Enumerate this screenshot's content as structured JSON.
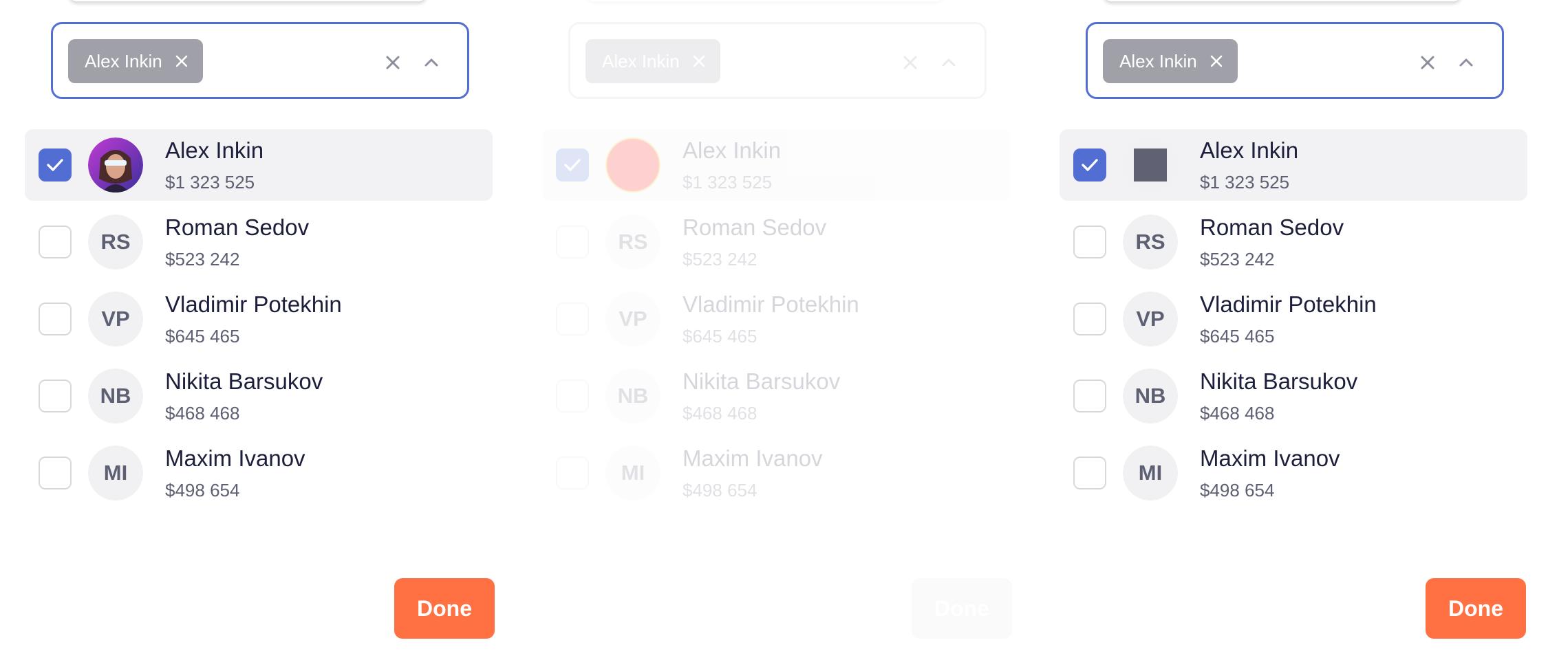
{
  "panels": [
    {
      "state": "active",
      "chip_label": "Alex Inkin",
      "avatar_style": "photo",
      "items": [
        {
          "name": "Alex Inkin",
          "amount": "$1 323 525",
          "initials": "",
          "checked": true
        },
        {
          "name": "Roman Sedov",
          "amount": "$523 242",
          "initials": "RS",
          "checked": false
        },
        {
          "name": "Vladimir Potekhin",
          "amount": "$645 465",
          "initials": "VP",
          "checked": false
        },
        {
          "name": "Nikita Barsukov",
          "amount": "$468 468",
          "initials": "NB",
          "checked": false
        },
        {
          "name": "Maxim Ivanov",
          "amount": "$498 654",
          "initials": "MI",
          "checked": false
        }
      ],
      "done_label": "Done"
    },
    {
      "state": "disabled",
      "chip_label": "Alex Inkin",
      "avatar_style": "red-circle",
      "items": [
        {
          "name": "Alex Inkin",
          "amount": "$1 323 525",
          "initials": "",
          "checked": true
        },
        {
          "name": "Roman Sedov",
          "amount": "$523 242",
          "initials": "RS",
          "checked": false
        },
        {
          "name": "Vladimir Potekhin",
          "amount": "$645 465",
          "initials": "VP",
          "checked": false
        },
        {
          "name": "Nikita Barsukov",
          "amount": "$468 468",
          "initials": "NB",
          "checked": false
        },
        {
          "name": "Maxim Ivanov",
          "amount": "$498 654",
          "initials": "MI",
          "checked": false
        }
      ],
      "done_label": "Done"
    },
    {
      "state": "active",
      "chip_label": "Alex Inkin",
      "avatar_style": "gray-square",
      "items": [
        {
          "name": "Alex Inkin",
          "amount": "$1 323 525",
          "initials": "",
          "checked": true
        },
        {
          "name": "Roman Sedov",
          "amount": "$523 242",
          "initials": "RS",
          "checked": false
        },
        {
          "name": "Vladimir Potekhin",
          "amount": "$645 465",
          "initials": "VP",
          "checked": false
        },
        {
          "name": "Nikita Barsukov",
          "amount": "$468 468",
          "initials": "NB",
          "checked": false
        },
        {
          "name": "Maxim Ivanov",
          "amount": "$498 654",
          "initials": "MI",
          "checked": false
        }
      ],
      "done_label": "Done"
    }
  ],
  "colors": {
    "accent": "#526ed3",
    "done_button": "#ff7142",
    "chip": "#9fa0a8",
    "selected_row": "#f2f2f4"
  },
  "icons": {
    "chip_remove": "close-icon",
    "clear": "close-icon",
    "collapse": "chevron-up-icon",
    "check": "check-icon"
  }
}
